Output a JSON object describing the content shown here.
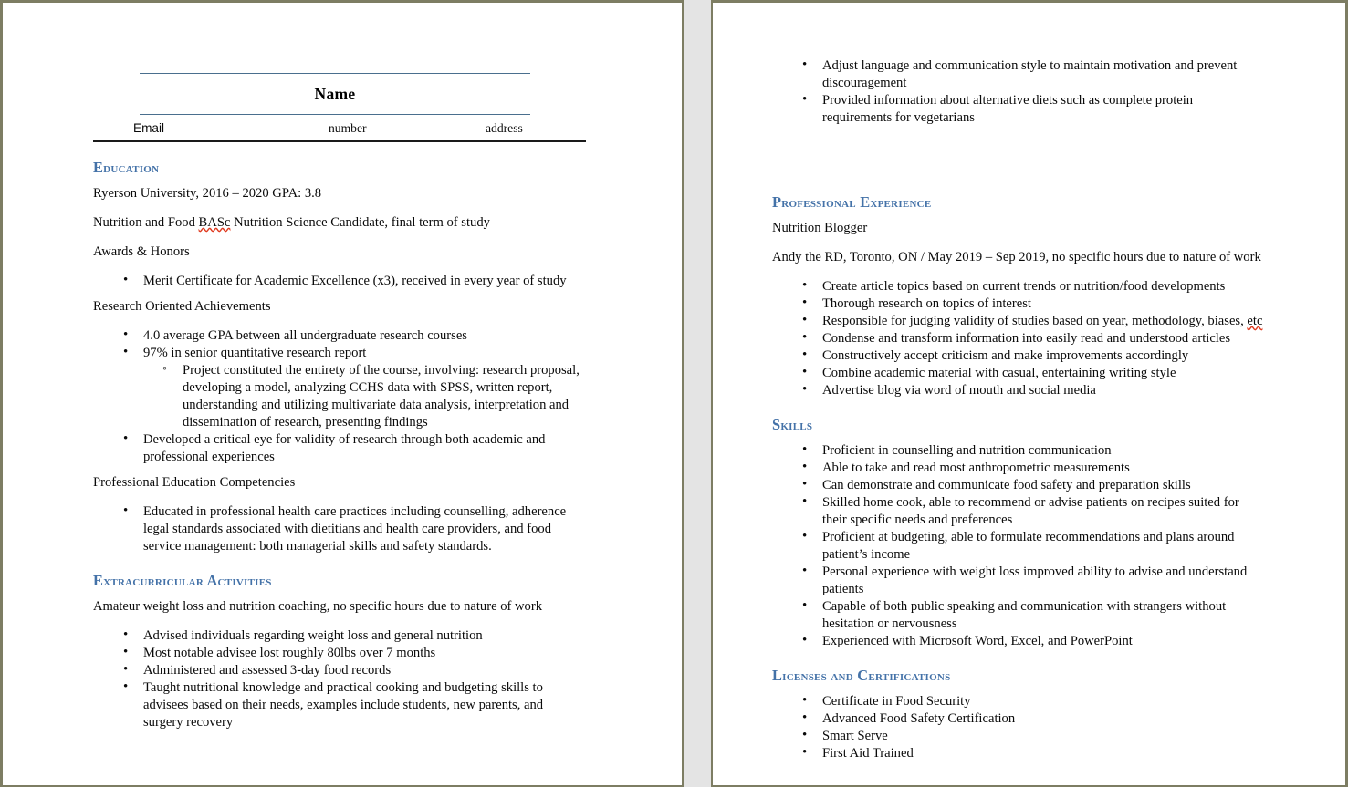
{
  "document": {
    "type": "resume",
    "page_count": 2,
    "accent_color": "#4472a8",
    "rule_color": "#4a6f8e",
    "border_color": "#7d7d63",
    "gutter_color": "#e4e4e4"
  },
  "header": {
    "name": "Name",
    "email_label": "Email",
    "phone_label": "number",
    "address_label": "address"
  },
  "page1": {
    "education": {
      "heading": "Education",
      "school_line": "Ryerson University, 2016 – 2020       GPA: 3.8",
      "program_line_pre": "Nutrition and Food ",
      "program_line_misspelled": "BASc",
      "program_line_post": " Nutrition Science Candidate, final term of study",
      "awards_label": "Awards & Honors",
      "awards_items": [
        "Merit Certificate for Academic Excellence (x3), received in every year of study"
      ],
      "research_label": "Research Oriented Achievements",
      "research_items": [
        "4.0 average GPA between all undergraduate research courses",
        "97% in senior quantitative research report",
        "Developed a critical eye for validity of research through both academic and professional experiences"
      ],
      "research_sub_items": [
        "Project constituted the entirety of the course, involving: research proposal, developing a model, analyzing CCHS data with SPSS, written report, understanding and utilizing multivariate data analysis, interpretation and dissemination of research, presenting findings"
      ],
      "competencies_label": "Professional Education Competencies",
      "competencies_items": [
        "Educated in professional health care practices including counselling, adherence legal standards associated with dietitians and health care providers, and food service management: both managerial skills and safety standards."
      ]
    },
    "extracurricular": {
      "heading": "Extracurricular Activities",
      "subtitle": "Amateur weight loss and nutrition coaching, no specific hours due to nature of work",
      "items": [
        "Advised individuals regarding weight loss and general nutrition",
        "Most notable advisee lost roughly 80lbs over 7 months",
        "Administered and assessed 3-day food records",
        "Taught nutritional knowledge and practical cooking and budgeting skills to advisees based on their needs, examples include students, new parents, and surgery recovery"
      ]
    }
  },
  "page2": {
    "continued_items": [
      "Adjust language and communication style to maintain motivation and prevent discouragement",
      "Provided information about alternative diets such as complete protein requirements for vegetarians"
    ],
    "professional_experience": {
      "heading": "Professional Experience",
      "job_title": "Nutrition Blogger",
      "job_meta": "Andy the RD, Toronto, ON / May 2019 – Sep 2019, no specific hours due to nature of work",
      "items": [
        "Create article topics based on current trends or nutrition/food developments",
        "Thorough research on topics of interest",
        "Condense and transform information into easily read and understood articles",
        "Constructively accept criticism and make improvements accordingly",
        "Combine academic material with casual, entertaining writing style",
        "Advertise blog via word of mouth and social media"
      ],
      "item_with_misspell_pre": "Responsible for judging validity of studies based on year, methodology, biases, ",
      "item_with_misspell_word": "etc"
    },
    "skills": {
      "heading": "Skills",
      "items": [
        "Proficient in counselling and nutrition communication",
        "Able to take and read most anthropometric measurements",
        "Can demonstrate and communicate food safety and preparation skills",
        "Skilled home cook, able to recommend or advise patients on recipes suited for their specific needs and preferences",
        "Proficient at budgeting, able to formulate recommendations and plans around patient’s income",
        "Personal experience with weight loss improved ability to advise and understand patients",
        "Capable of both public speaking and communication with strangers without hesitation or nervousness",
        "Experienced with Microsoft Word, Excel, and PowerPoint"
      ]
    },
    "licenses": {
      "heading": "Licenses and Certifications",
      "items": [
        "Certificate in Food Security",
        "Advanced Food Safety Certification",
        "Smart Serve",
        "First Aid Trained"
      ]
    }
  }
}
